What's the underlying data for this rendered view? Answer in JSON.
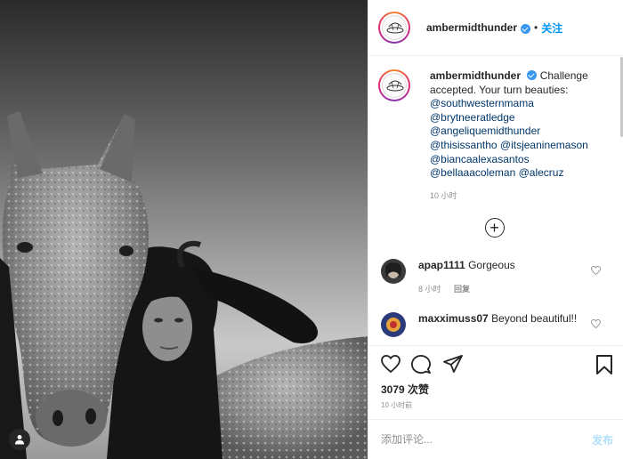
{
  "post": {
    "username": "ambermidthunder",
    "follow_label": "关注",
    "separator": "•"
  },
  "caption": {
    "username": "ambermidthunder",
    "text": "Challenge accepted. Your turn beauties:",
    "mentions": [
      "@southwesternmama",
      "@brytneeratledge",
      "@angeliquemidthunder",
      "@thisissantho",
      "@itsjeaninemason",
      "@biancaalexasantos",
      "@bellaaacoleman",
      "@alecruz"
    ],
    "time": "10 小时"
  },
  "comments": [
    {
      "username": "apap1111",
      "text": "Gorgeous",
      "time": "8 小时",
      "reply_label": "回复"
    },
    {
      "username": "maxximuss07",
      "text": "Beyond beautiful!!",
      "time": "",
      "reply_label": ""
    }
  ],
  "likes_text": "3079 次赞",
  "posted_time": "10 小时前",
  "comment_box": {
    "placeholder": "添加评论...",
    "post_label": "发布"
  },
  "icons": {
    "verified": "verified-badge-icon",
    "load_more": "plus-circle-icon",
    "like": "heart-icon",
    "comment": "comment-bubble-icon",
    "share": "paper-plane-icon",
    "save": "bookmark-icon",
    "tag": "user-tag-icon"
  },
  "colors": {
    "accent": "#0095f6",
    "verified": "#3897f0",
    "post_disabled": "#b2dffc",
    "mention": "#00376b"
  }
}
